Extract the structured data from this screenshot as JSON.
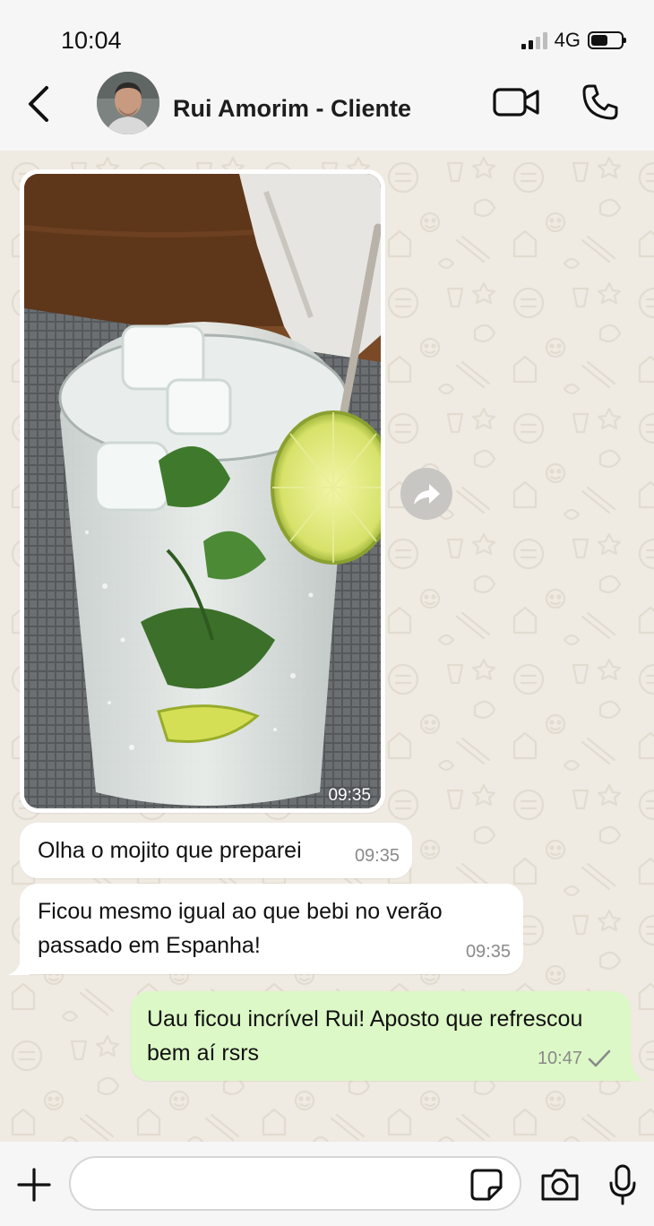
{
  "status_bar": {
    "time": "10:04",
    "network": "4G"
  },
  "header": {
    "contact_name": "Rui Amorim - Cliente",
    "icons": [
      "back-chevron-icon",
      "video-call-icon",
      "phone-call-icon"
    ]
  },
  "messages": [
    {
      "type": "image",
      "direction": "incoming",
      "subject": "mojito",
      "time": "09:35"
    },
    {
      "type": "text",
      "direction": "incoming",
      "text": "Olha o mojito que preparei",
      "time": "09:35"
    },
    {
      "type": "text",
      "direction": "incoming",
      "text": "Ficou mesmo igual ao que bebi no verão passado em Espanha!",
      "time": "09:35"
    },
    {
      "type": "text",
      "direction": "outgoing",
      "text": "Uau ficou incrível Rui! Aposto que refrescou bem aí rsrs",
      "time": "10:47",
      "status": "sent"
    }
  ],
  "input_bar": {
    "message_value": "",
    "icons": [
      "plus-icon",
      "sticker-icon",
      "camera-icon",
      "microphone-icon"
    ]
  },
  "colors": {
    "chat_background": "#efeae2",
    "outgoing_bubble": "#dcf8c6",
    "incoming_bubble": "#ffffff",
    "timestamp": "#8a8a8a"
  }
}
